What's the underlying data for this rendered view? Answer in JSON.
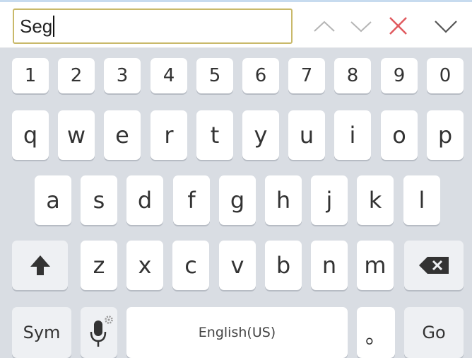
{
  "find_bar": {
    "query": "Seg",
    "icons": [
      "chevron-up-icon",
      "chevron-down-icon",
      "close-x-icon",
      "collapse-chevron-icon"
    ],
    "close_color": "#e0595e"
  },
  "keyboard": {
    "row_numbers": [
      "1",
      "2",
      "3",
      "4",
      "5",
      "6",
      "7",
      "8",
      "9",
      "0"
    ],
    "row_top": [
      "q",
      "w",
      "e",
      "r",
      "t",
      "y",
      "u",
      "i",
      "o",
      "p"
    ],
    "row_mid": [
      "a",
      "s",
      "d",
      "f",
      "g",
      "h",
      "j",
      "k",
      "l"
    ],
    "row_bottom": [
      "z",
      "x",
      "c",
      "v",
      "b",
      "n",
      "m"
    ],
    "shift_icon": "shift-up-arrow-icon",
    "backspace_icon": "backspace-icon",
    "sym_label": "Sym",
    "mic_icon": "microphone-settings-icon",
    "space_label": "English(US)",
    "period_label": "。",
    "go_label": "Go"
  }
}
